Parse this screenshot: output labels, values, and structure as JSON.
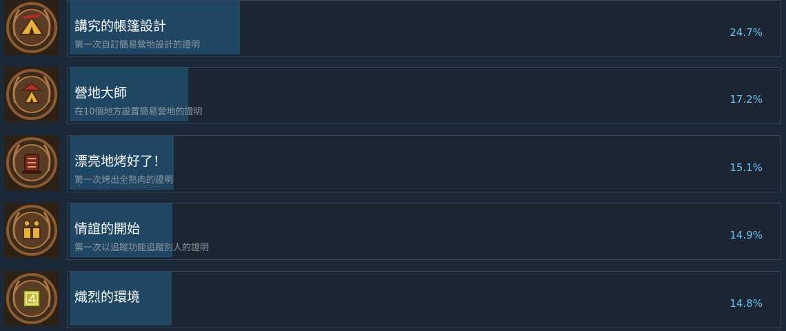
{
  "achievements": [
    {
      "title": "講究的帳篷設計",
      "description": "第一次自訂簡易營地設計的證明",
      "percent_text": "24.7%",
      "percent": 24.7,
      "icon": "tent-emblem-icon"
    },
    {
      "title": "營地大師",
      "description": "在10個地方設置簡易營地的證明",
      "percent_text": "17.2%",
      "percent": 17.2,
      "icon": "camp-master-emblem-icon"
    },
    {
      "title": "漂亮地烤好了！",
      "description": "第一次烤出全熟肉的證明",
      "percent_text": "15.1%",
      "percent": 15.1,
      "icon": "grill-emblem-icon"
    },
    {
      "title": "情誼的開始",
      "description": "第一次以追蹤功能追蹤別人的證明",
      "percent_text": "14.9%",
      "percent": 14.9,
      "icon": "friendship-emblem-icon"
    },
    {
      "title": "熾烈的環境",
      "description": "",
      "percent_text": "14.8%",
      "percent": 14.8,
      "icon": "fierce-environment-emblem-icon"
    }
  ],
  "colors": {
    "background": "#1b2838",
    "progress_fill": "#1f4764",
    "percent_text": "#66c0f4",
    "title_text": "#ffffff",
    "description_text": "#8f98a0",
    "emblem_bronze": "#8a5a34"
  }
}
